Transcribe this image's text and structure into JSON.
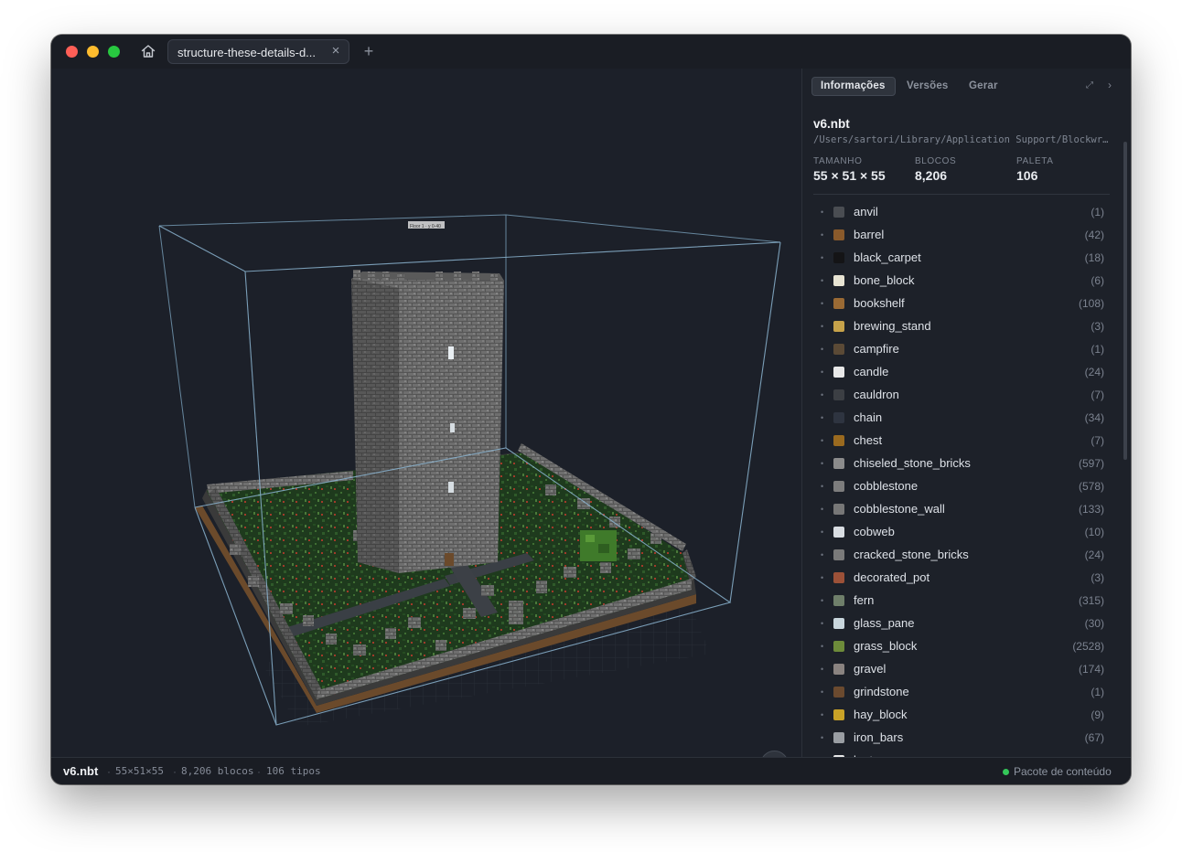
{
  "window": {
    "tab_title": "structure-these-details-d...",
    "tab_close_icon": "close-icon",
    "new_tab_label": "+"
  },
  "viewport": {
    "overlay_text": "Floor 1 · y 0-40",
    "help_label": "?"
  },
  "panel": {
    "tabs": [
      {
        "label": "Informações",
        "active": true
      },
      {
        "label": "Versões",
        "active": false
      },
      {
        "label": "Gerar",
        "active": false
      }
    ],
    "file_name": "v6.nbt",
    "file_path": "/Users/sartori/Library/Application Support/Blockwr...",
    "stats": [
      {
        "label": "TAMANHO",
        "value": "55 × 51 × 55"
      },
      {
        "label": "BLOCOS",
        "value": "8,206"
      },
      {
        "label": "PALETA",
        "value": "106"
      }
    ],
    "blocks": [
      {
        "name": "anvil",
        "count": "(1)",
        "color": "#4a4d52"
      },
      {
        "name": "barrel",
        "count": "(42)",
        "color": "#8a5a2b"
      },
      {
        "name": "black_carpet",
        "count": "(18)",
        "color": "#141416"
      },
      {
        "name": "bone_block",
        "count": "(6)",
        "color": "#e7e3d2"
      },
      {
        "name": "bookshelf",
        "count": "(108)",
        "color": "#9a6a34"
      },
      {
        "name": "brewing_stand",
        "count": "(3)",
        "color": "#c6a24a"
      },
      {
        "name": "campfire",
        "count": "(1)",
        "color": "#5b4a36"
      },
      {
        "name": "candle",
        "count": "(24)",
        "color": "#e8e8e8"
      },
      {
        "name": "cauldron",
        "count": "(7)",
        "color": "#3c3f44"
      },
      {
        "name": "chain",
        "count": "(34)",
        "color": "#2e3440"
      },
      {
        "name": "chest",
        "count": "(7)",
        "color": "#9a6a1f"
      },
      {
        "name": "chiseled_stone_bricks",
        "count": "(597)",
        "color": "#8c8c8c"
      },
      {
        "name": "cobblestone",
        "count": "(578)",
        "color": "#7d7d7d"
      },
      {
        "name": "cobblestone_wall",
        "count": "(133)",
        "color": "#777777"
      },
      {
        "name": "cobweb",
        "count": "(10)",
        "color": "#d9dde2"
      },
      {
        "name": "cracked_stone_bricks",
        "count": "(24)",
        "color": "#7a7a7a"
      },
      {
        "name": "decorated_pot",
        "count": "(3)",
        "color": "#9c5138"
      },
      {
        "name": "fern",
        "count": "(315)",
        "color": "#6f7f6a"
      },
      {
        "name": "glass_pane",
        "count": "(30)",
        "color": "#c9d6dd"
      },
      {
        "name": "grass_block",
        "count": "(2528)",
        "color": "#6d8b3a"
      },
      {
        "name": "gravel",
        "count": "(174)",
        "color": "#8a8380"
      },
      {
        "name": "grindstone",
        "count": "(1)",
        "color": "#6b4a2f"
      },
      {
        "name": "hay_block",
        "count": "(9)",
        "color": "#c9a227"
      },
      {
        "name": "iron_bars",
        "count": "(67)",
        "color": "#9a9ea3"
      },
      {
        "name": "lantern",
        "count": "",
        "color": "#e8e8e8"
      }
    ]
  },
  "statusbar": {
    "file": "v6.nbt",
    "dims": "55×51×55",
    "blocks": "8,206 blocos",
    "types": "106 tipos",
    "pack_label": "Pacote de conteúdo",
    "pack_status_color": "#34c759",
    "separator": "·"
  }
}
